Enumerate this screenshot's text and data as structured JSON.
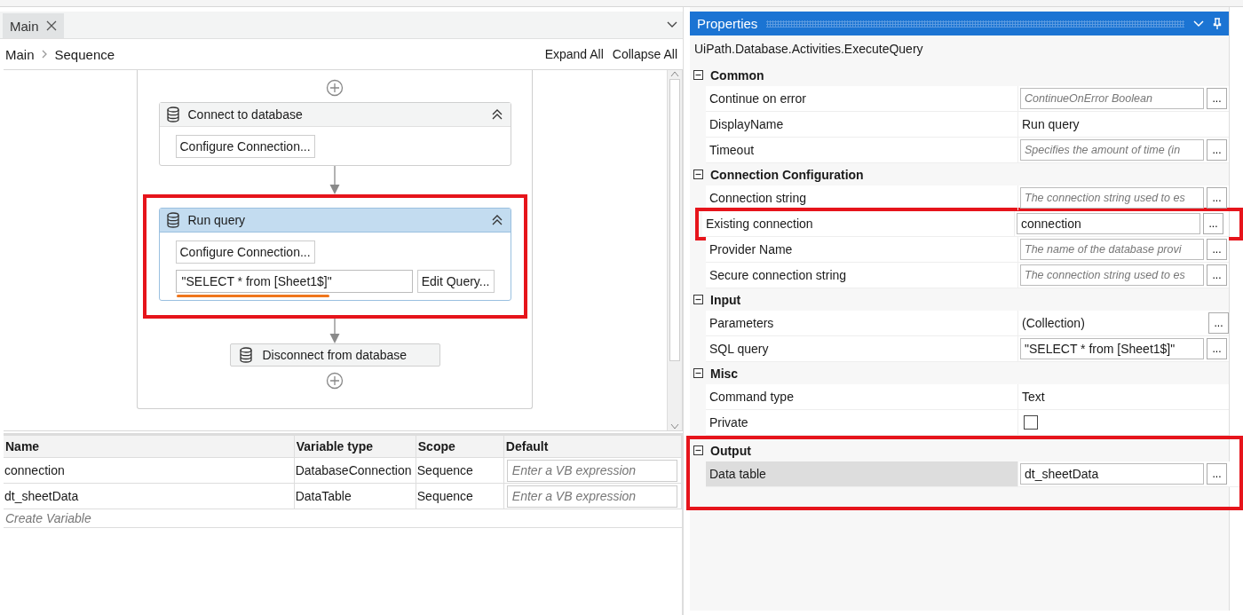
{
  "tabs": [
    {
      "label": "Main",
      "selected": true
    }
  ],
  "breadcrumb": [
    "Main",
    "Sequence"
  ],
  "toolbar": [
    "Expand All",
    "Collapse All"
  ],
  "activities": [
    {
      "kind": "card",
      "title": "Connect to database",
      "selected": false,
      "highlighted": false,
      "buttons": [
        "Configure Connection..."
      ]
    },
    {
      "kind": "card",
      "title": "Run query",
      "selected": true,
      "highlighted": true,
      "buttons": [
        "Configure Connection..."
      ],
      "query": {
        "value": "\"SELECT * from [Sheet1$]\"",
        "underlined": true,
        "button": "Edit Query..."
      }
    },
    {
      "kind": "compact",
      "title": "Disconnect from database",
      "selected": false,
      "highlighted": false
    }
  ],
  "variables": {
    "columns": [
      "Name",
      "Variable type",
      "Scope",
      "Default"
    ],
    "rows": [
      {
        "name": "connection",
        "type": "DatabaseConnection",
        "scope": "Sequence",
        "default_placeholder": "Enter a VB expression"
      },
      {
        "name": "dt_sheetData",
        "type": "DataTable",
        "scope": "Sequence",
        "default_placeholder": "Enter a VB expression"
      }
    ],
    "create_label": "Create Variable"
  },
  "properties": {
    "title": "Properties",
    "type_name": "UiPath.Database.Activities.ExecuteQuery",
    "categories": [
      {
        "name": "Common",
        "expanded": true,
        "highlighted": false,
        "rows": [
          {
            "label": "Continue on error",
            "kind": "field",
            "placeholder": "ContinueOnError Boolean",
            "button": "...",
            "selected": false,
            "highlighted": false
          },
          {
            "label": "DisplayName",
            "kind": "text",
            "value": "Run query",
            "selected": false,
            "highlighted": false
          },
          {
            "label": "Timeout",
            "kind": "field",
            "placeholder": "Specifies the amount of time (in",
            "button": "...",
            "selected": false,
            "highlighted": false
          }
        ]
      },
      {
        "name": "Connection Configuration",
        "expanded": true,
        "highlighted": false,
        "rows": [
          {
            "label": "Connection string",
            "kind": "field",
            "placeholder": "The connection string used to es",
            "button": "...",
            "selected": false,
            "highlighted": false
          },
          {
            "label": "Existing connection",
            "kind": "field",
            "value": "connection",
            "button": "...",
            "selected": false,
            "highlighted": true
          },
          {
            "label": "Provider Name",
            "kind": "field",
            "placeholder": "The name of the database provi",
            "button": "...",
            "selected": false,
            "highlighted": false
          },
          {
            "label": "Secure connection string",
            "kind": "field",
            "placeholder": "The connection string used to es",
            "button": "...",
            "selected": false,
            "highlighted": false
          }
        ]
      },
      {
        "name": "Input",
        "expanded": true,
        "highlighted": false,
        "rows": [
          {
            "label": "Parameters",
            "kind": "text",
            "value": "(Collection)",
            "button": "...",
            "selected": false,
            "highlighted": false
          },
          {
            "label": "SQL query",
            "kind": "field",
            "value": "\"SELECT * from [Sheet1$]\"",
            "button": "...",
            "selected": false,
            "highlighted": false
          }
        ]
      },
      {
        "name": "Misc",
        "expanded": true,
        "highlighted": false,
        "rows": [
          {
            "label": "Command type",
            "kind": "text",
            "value": "Text",
            "selected": false,
            "highlighted": false
          },
          {
            "label": "Private",
            "kind": "checkbox",
            "checked": false,
            "selected": false,
            "highlighted": false
          }
        ]
      },
      {
        "name": "Output",
        "expanded": true,
        "highlighted": true,
        "rows": [
          {
            "label": "Data table",
            "kind": "field",
            "value": "dt_sheetData",
            "button": "...",
            "selected": true,
            "highlighted": false
          }
        ]
      }
    ]
  }
}
